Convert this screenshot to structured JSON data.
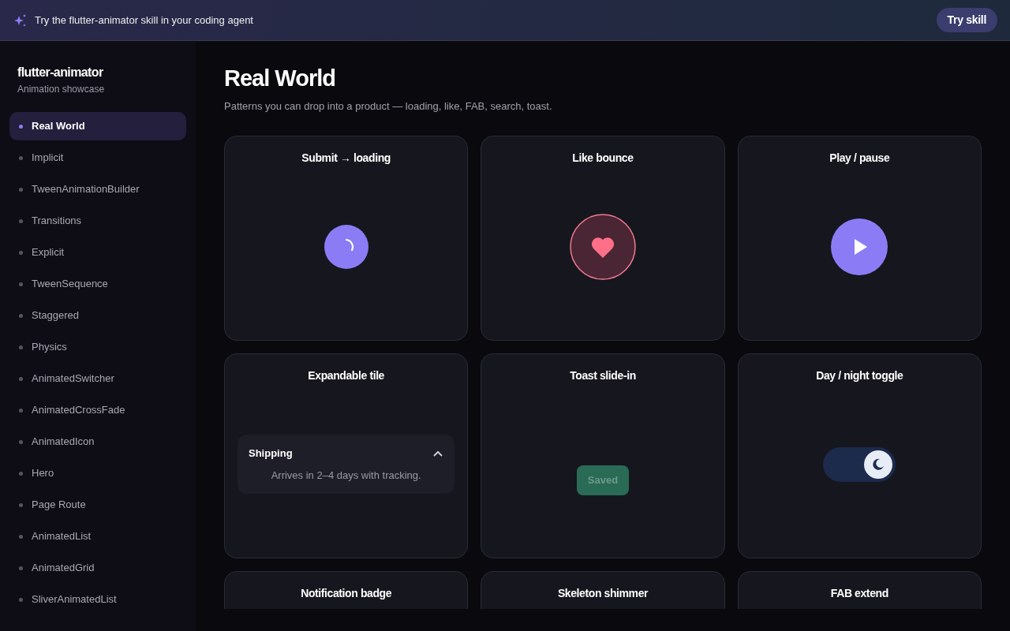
{
  "banner": {
    "text": "Try the flutter-animator skill in your coding agent",
    "button": "Try skill"
  },
  "sidebar": {
    "title": "flutter-animator",
    "subtitle": "Animation showcase",
    "items": [
      {
        "label": "Real World",
        "selected": true
      },
      {
        "label": "Implicit",
        "selected": false
      },
      {
        "label": "TweenAnimationBuilder",
        "selected": false
      },
      {
        "label": "Transitions",
        "selected": false
      },
      {
        "label": "Explicit",
        "selected": false
      },
      {
        "label": "TweenSequence",
        "selected": false
      },
      {
        "label": "Staggered",
        "selected": false
      },
      {
        "label": "Physics",
        "selected": false
      },
      {
        "label": "AnimatedSwitcher",
        "selected": false
      },
      {
        "label": "AnimatedCrossFade",
        "selected": false
      },
      {
        "label": "AnimatedIcon",
        "selected": false
      },
      {
        "label": "Hero",
        "selected": false
      },
      {
        "label": "Page Route",
        "selected": false
      },
      {
        "label": "AnimatedList",
        "selected": false
      },
      {
        "label": "AnimatedGrid",
        "selected": false
      },
      {
        "label": "SliverAnimatedList",
        "selected": false
      }
    ]
  },
  "page": {
    "title": "Real World",
    "subtitle": "Patterns you can drop into a product — loading, like, FAB, search, toast."
  },
  "cards": [
    {
      "title": "Submit → loading",
      "kind": "spinner"
    },
    {
      "title": "Like bounce",
      "kind": "like",
      "liked": true
    },
    {
      "title": "Play / pause",
      "kind": "play",
      "playing": false
    },
    {
      "title": "Expandable tile",
      "kind": "tile",
      "tile_title": "Shipping",
      "tile_body": "Arrives in 2–4 days with tracking.",
      "expanded": true
    },
    {
      "title": "Toast slide-in",
      "kind": "toast",
      "toast": "Saved"
    },
    {
      "title": "Day / night toggle",
      "kind": "toggle",
      "on": true
    },
    {
      "title": "Notification badge",
      "kind": "empty"
    },
    {
      "title": "Skeleton shimmer",
      "kind": "empty"
    },
    {
      "title": "FAB extend",
      "kind": "empty"
    }
  ]
}
